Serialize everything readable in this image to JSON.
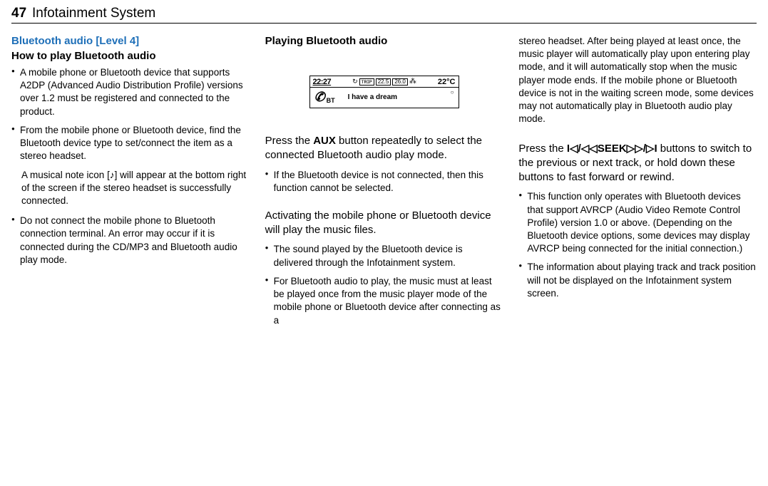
{
  "header": {
    "page_num": "47",
    "title": "Infotainment System"
  },
  "col1": {
    "h_blue": "Bluetooth audio [Level 4]",
    "h_sub": "How to play Bluetooth audio",
    "b1": "A mobile phone or Bluetooth device that supports A2DP (Advanced Audio Distribution Profile) versions over 1.2 must be registered and connected to the product.",
    "b2": "From the mobile phone or Bluetooth device, find the Bluetooth device type to set/connect the item as a stereo headset.",
    "note1": "A musical note icon [♪] will appear at the bottom right of the screen if the stereo headset is successfully connected.",
    "b3": "Do not connect the mobile phone to Bluetooth connection terminal. An error may occur if it is connected during the CD/MP3 and Bluetooth audio play mode."
  },
  "col2": {
    "h": "Playing Bluetooth audio",
    "screen": {
      "time": "22:27",
      "km": "22.5",
      "mpg": "26.0",
      "temp": "22°C",
      "bt": "BT",
      "track": "I have a dream"
    },
    "p1_a": "Press the ",
    "p1_bold": "AUX",
    "p1_b": " button repeatedly to select the connected Bluetooth audio play mode.",
    "b1": "If the Bluetooth device is not connected, then this function cannot be selected.",
    "p2": "Activating the mobile phone or Bluetooth device will play the music files.",
    "b2": "The sound played by the Bluetooth device is delivered through the Infotainment system.",
    "b3": "For Bluetooth audio to play, the music must at least be played once from the music player mode of the mobile phone or Bluetooth device after connecting as a"
  },
  "col3": {
    "p_cont": "stereo headset. After being played at least once, the music player will automatically play upon entering play mode, and it will automatically stop when the music player mode ends. If the mobile phone or Bluetooth device is not in the waiting screen mode, some devices may not automatically play in Bluetooth audio play mode.",
    "p2_a": "Press the ",
    "p2_bold": "I◁/◁◁SEEK▷▷/▷I",
    "p2_b": " buttons to switch to the previous or next track, or hold down these buttons to fast forward or rewind.",
    "b1": "This function only operates with Bluetooth devices that support AVRCP (Audio Video Remote Control Profile) version 1.0 or above. (Depending on the Bluetooth device options, some devices may display AVRCP being connected for the initial connection.)",
    "b2": "The information about playing track and track position will not be displayed on the Infotainment system screen."
  }
}
